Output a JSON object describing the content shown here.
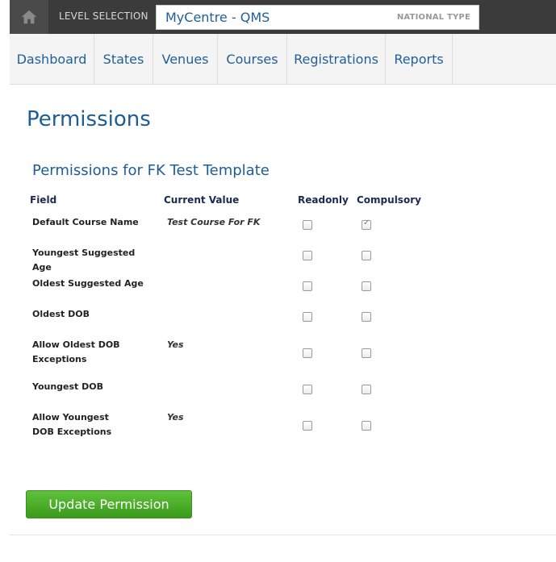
{
  "header": {
    "level_label": "LEVEL SELECTION",
    "level_name": "MyCentre - QMS",
    "level_type": "NATIONAL TYPE",
    "home_icon": "home-icon"
  },
  "nav": {
    "items": [
      {
        "label": "Dashboard"
      },
      {
        "label": "States"
      },
      {
        "label": "Venues"
      },
      {
        "label": "Courses"
      },
      {
        "label": "Registrations"
      },
      {
        "label": "Reports"
      }
    ]
  },
  "page": {
    "title": "Permissions",
    "subtitle": "Permissions for FK Test Template"
  },
  "table": {
    "headers": {
      "field": "Field",
      "value": "Current Value",
      "readonly": "Readonly",
      "compulsory": "Compulsory"
    },
    "rows": [
      {
        "field": "Default Course Name",
        "value": "Test Course For FK",
        "readonly": false,
        "compulsory": true
      },
      {
        "field": "Youngest Suggested Age",
        "value": "",
        "readonly": false,
        "compulsory": false
      },
      {
        "field": "Oldest Suggested Age",
        "value": "",
        "readonly": false,
        "compulsory": false
      },
      {
        "field": "Oldest DOB",
        "value": "",
        "readonly": false,
        "compulsory": false
      },
      {
        "field": "Allow Oldest DOB Exceptions",
        "value": "Yes",
        "readonly": false,
        "compulsory": false
      },
      {
        "field": "Youngest DOB",
        "value": "",
        "readonly": false,
        "compulsory": false
      },
      {
        "field": "Allow Youngest DOB Exceptions",
        "value": "Yes",
        "readonly": false,
        "compulsory": false
      }
    ]
  },
  "actions": {
    "update_label": "Update Permission"
  },
  "colors": {
    "accent": "#1d5d94",
    "button_green": "#4cae2b",
    "topbar": "#3b3b3b"
  }
}
